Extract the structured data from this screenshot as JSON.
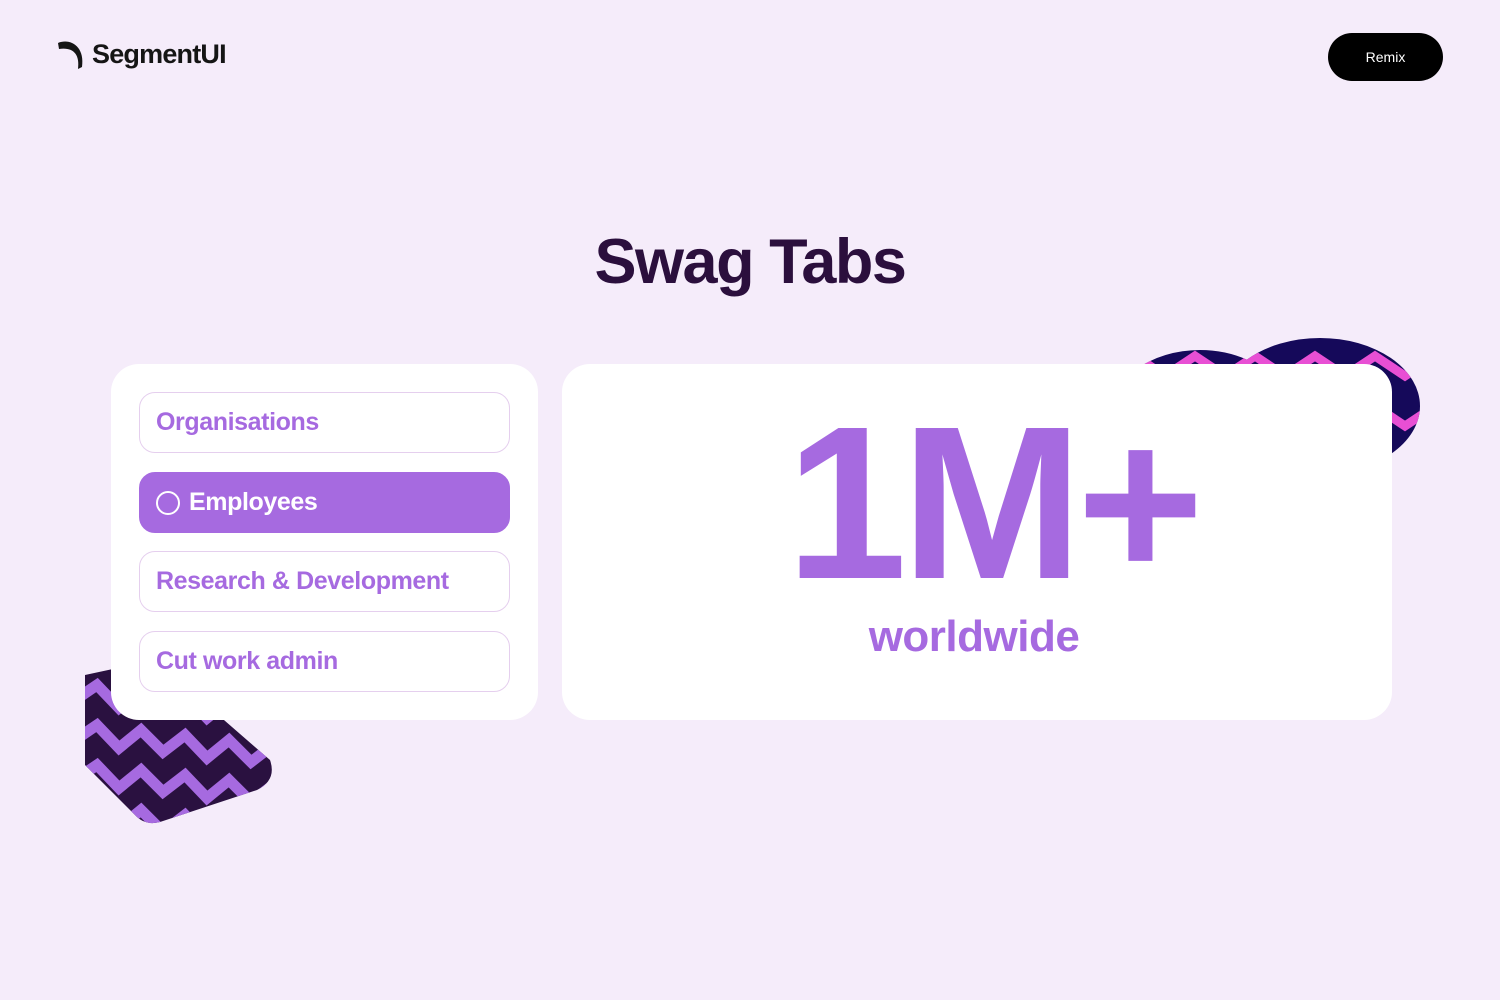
{
  "header": {
    "logo_text": "SegmentUI",
    "remix_label": "Remix"
  },
  "page_title": "Swag Tabs",
  "tabs": [
    {
      "label": "Organisations",
      "active": false
    },
    {
      "label": "Employees",
      "active": true
    },
    {
      "label": "Research & Development",
      "active": false
    },
    {
      "label": "Cut work admin",
      "active": false
    }
  ],
  "stat": {
    "value": "1M+",
    "caption": "worldwide"
  },
  "colors": {
    "background": "#f5ecfa",
    "accent": "#a66ae0",
    "title": "#2b0f3d",
    "button": "#000000"
  }
}
